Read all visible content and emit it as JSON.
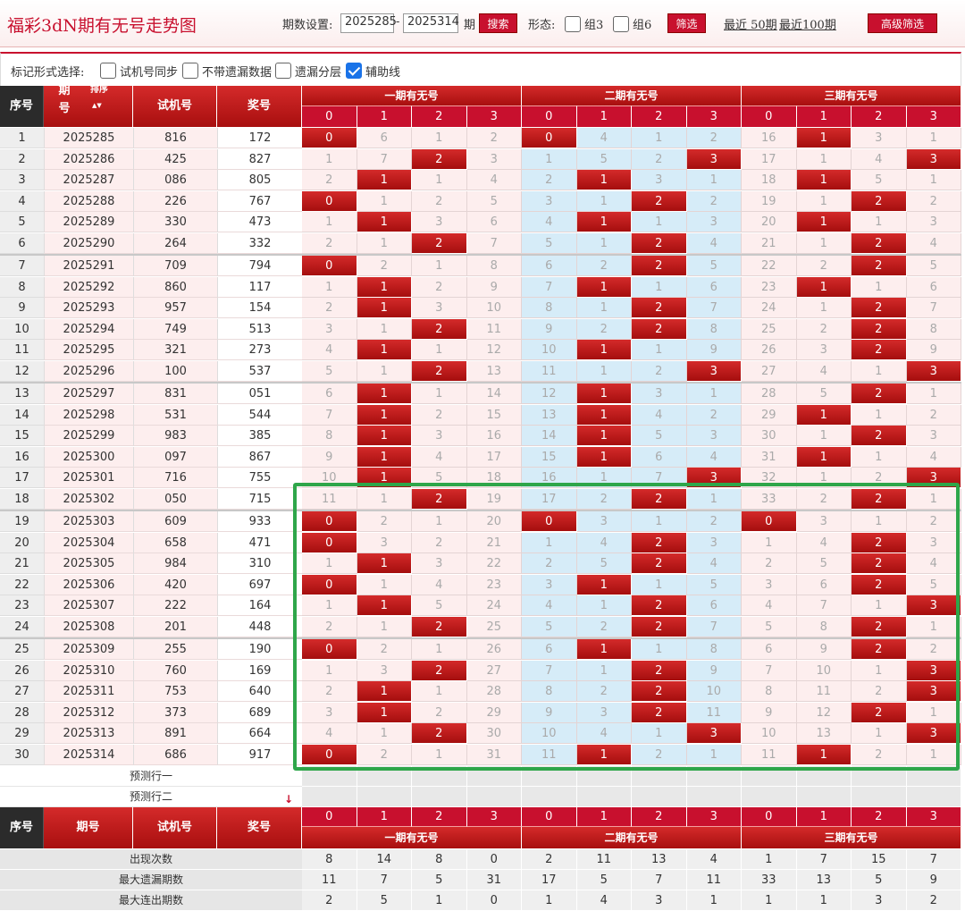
{
  "app": {
    "title": "福彩3dN期有无号走势图"
  },
  "toolbar": {
    "period_label": "期数设置:",
    "period_start": "2025285",
    "period_sep": "-",
    "period_end": "2025314",
    "period_unit": "期",
    "search_label": "搜索",
    "form_label": "形态:",
    "group3_label": "组3",
    "group6_label": "组6",
    "filter_label": "筛选",
    "recent50_label": "最近 50期",
    "recent100_label": "最近100期",
    "advanced_label": "高级筛选"
  },
  "options": {
    "label": "标记形式选择:",
    "items": [
      {
        "label": "试机号同步",
        "checked": false
      },
      {
        "label": "不带遗漏数据",
        "checked": false
      },
      {
        "label": "遗漏分层",
        "checked": false
      },
      {
        "label": "辅助线",
        "checked": true
      }
    ]
  },
  "table": {
    "headers": {
      "index": "序号",
      "period": "期号",
      "sort": "排序",
      "trial": "试机号",
      "winning": "奖号",
      "groups": [
        "一期有无号",
        "二期有无号",
        "三期有无号"
      ],
      "subcols": [
        "0",
        "1",
        "2",
        "3"
      ]
    },
    "rows": [
      {
        "i": "1",
        "p": "2025285",
        "t": "816",
        "w": "172",
        "v": [
          "0",
          "6",
          "1",
          "2",
          "0",
          "4",
          "1",
          "2",
          "16",
          "1",
          "3",
          "1"
        ]
      },
      {
        "i": "2",
        "p": "2025286",
        "t": "425",
        "w": "827",
        "v": [
          "1",
          "7",
          "2",
          "3",
          "1",
          "5",
          "2",
          "3",
          "17",
          "1",
          "4",
          "3"
        ]
      },
      {
        "i": "3",
        "p": "2025287",
        "t": "086",
        "w": "805",
        "v": [
          "2",
          "1",
          "1",
          "4",
          "2",
          "1",
          "3",
          "1",
          "18",
          "1",
          "5",
          "1"
        ]
      },
      {
        "i": "4",
        "p": "2025288",
        "t": "226",
        "w": "767",
        "v": [
          "0",
          "1",
          "2",
          "5",
          "3",
          "1",
          "2",
          "2",
          "19",
          "1",
          "2",
          "2"
        ]
      },
      {
        "i": "5",
        "p": "2025289",
        "t": "330",
        "w": "473",
        "v": [
          "1",
          "1",
          "3",
          "6",
          "4",
          "1",
          "1",
          "3",
          "20",
          "1",
          "1",
          "3"
        ]
      },
      {
        "i": "6",
        "p": "2025290",
        "t": "264",
        "w": "332",
        "v": [
          "2",
          "1",
          "2",
          "7",
          "5",
          "1",
          "2",
          "4",
          "21",
          "1",
          "2",
          "4"
        ]
      },
      {
        "i": "7",
        "p": "2025291",
        "t": "709",
        "w": "794",
        "v": [
          "0",
          "2",
          "1",
          "8",
          "6",
          "2",
          "2",
          "5",
          "22",
          "2",
          "2",
          "5"
        ]
      },
      {
        "i": "8",
        "p": "2025292",
        "t": "860",
        "w": "117",
        "v": [
          "1",
          "1",
          "2",
          "9",
          "7",
          "1",
          "1",
          "6",
          "23",
          "1",
          "1",
          "6"
        ]
      },
      {
        "i": "9",
        "p": "2025293",
        "t": "957",
        "w": "154",
        "v": [
          "2",
          "1",
          "3",
          "10",
          "8",
          "1",
          "2",
          "7",
          "24",
          "1",
          "2",
          "7"
        ]
      },
      {
        "i": "10",
        "p": "2025294",
        "t": "749",
        "w": "513",
        "v": [
          "3",
          "1",
          "2",
          "11",
          "9",
          "2",
          "2",
          "8",
          "25",
          "2",
          "2",
          "8"
        ]
      },
      {
        "i": "11",
        "p": "2025295",
        "t": "321",
        "w": "273",
        "v": [
          "4",
          "1",
          "1",
          "12",
          "10",
          "1",
          "1",
          "9",
          "26",
          "3",
          "2",
          "9"
        ]
      },
      {
        "i": "12",
        "p": "2025296",
        "t": "100",
        "w": "537",
        "v": [
          "5",
          "1",
          "2",
          "13",
          "11",
          "1",
          "2",
          "3",
          "27",
          "4",
          "1",
          "3"
        ]
      },
      {
        "i": "13",
        "p": "2025297",
        "t": "831",
        "w": "051",
        "v": [
          "6",
          "1",
          "1",
          "14",
          "12",
          "1",
          "3",
          "1",
          "28",
          "5",
          "2",
          "1"
        ]
      },
      {
        "i": "14",
        "p": "2025298",
        "t": "531",
        "w": "544",
        "v": [
          "7",
          "1",
          "2",
          "15",
          "13",
          "1",
          "4",
          "2",
          "29",
          "1",
          "1",
          "2"
        ]
      },
      {
        "i": "15",
        "p": "2025299",
        "t": "983",
        "w": "385",
        "v": [
          "8",
          "1",
          "3",
          "16",
          "14",
          "1",
          "5",
          "3",
          "30",
          "1",
          "2",
          "3"
        ]
      },
      {
        "i": "16",
        "p": "2025300",
        "t": "097",
        "w": "867",
        "v": [
          "9",
          "1",
          "4",
          "17",
          "15",
          "1",
          "6",
          "4",
          "31",
          "1",
          "1",
          "4"
        ]
      },
      {
        "i": "17",
        "p": "2025301",
        "t": "716",
        "w": "755",
        "v": [
          "10",
          "1",
          "5",
          "18",
          "16",
          "1",
          "7",
          "3",
          "32",
          "1",
          "2",
          "3"
        ]
      },
      {
        "i": "18",
        "p": "2025302",
        "t": "050",
        "w": "715",
        "v": [
          "11",
          "1",
          "2",
          "19",
          "17",
          "2",
          "2",
          "1",
          "33",
          "2",
          "2",
          "1"
        ]
      },
      {
        "i": "19",
        "p": "2025303",
        "t": "609",
        "w": "933",
        "v": [
          "0",
          "2",
          "1",
          "20",
          "0",
          "3",
          "1",
          "2",
          "0",
          "3",
          "1",
          "2"
        ]
      },
      {
        "i": "20",
        "p": "2025304",
        "t": "658",
        "w": "471",
        "v": [
          "0",
          "3",
          "2",
          "21",
          "1",
          "4",
          "2",
          "3",
          "1",
          "4",
          "2",
          "3"
        ]
      },
      {
        "i": "21",
        "p": "2025305",
        "t": "984",
        "w": "310",
        "v": [
          "1",
          "1",
          "3",
          "22",
          "2",
          "5",
          "2",
          "4",
          "2",
          "5",
          "2",
          "4"
        ]
      },
      {
        "i": "22",
        "p": "2025306",
        "t": "420",
        "w": "697",
        "v": [
          "0",
          "1",
          "4",
          "23",
          "3",
          "1",
          "1",
          "5",
          "3",
          "6",
          "2",
          "5"
        ]
      },
      {
        "i": "23",
        "p": "2025307",
        "t": "222",
        "w": "164",
        "v": [
          "1",
          "1",
          "5",
          "24",
          "4",
          "1",
          "2",
          "6",
          "4",
          "7",
          "1",
          "3"
        ]
      },
      {
        "i": "24",
        "p": "2025308",
        "t": "201",
        "w": "448",
        "v": [
          "2",
          "1",
          "2",
          "25",
          "5",
          "2",
          "2",
          "7",
          "5",
          "8",
          "2",
          "1"
        ]
      },
      {
        "i": "25",
        "p": "2025309",
        "t": "255",
        "w": "190",
        "v": [
          "0",
          "2",
          "1",
          "26",
          "6",
          "1",
          "1",
          "8",
          "6",
          "9",
          "2",
          "2"
        ]
      },
      {
        "i": "26",
        "p": "2025310",
        "t": "760",
        "w": "169",
        "v": [
          "1",
          "3",
          "2",
          "27",
          "7",
          "1",
          "2",
          "9",
          "7",
          "10",
          "1",
          "3"
        ]
      },
      {
        "i": "27",
        "p": "2025311",
        "t": "753",
        "w": "640",
        "v": [
          "2",
          "1",
          "1",
          "28",
          "8",
          "2",
          "2",
          "10",
          "8",
          "11",
          "2",
          "3"
        ]
      },
      {
        "i": "28",
        "p": "2025312",
        "t": "373",
        "w": "689",
        "v": [
          "3",
          "1",
          "2",
          "29",
          "9",
          "3",
          "2",
          "11",
          "9",
          "12",
          "2",
          "1"
        ]
      },
      {
        "i": "29",
        "p": "2025313",
        "t": "891",
        "w": "664",
        "v": [
          "4",
          "1",
          "2",
          "30",
          "10",
          "4",
          "1",
          "3",
          "10",
          "13",
          "1",
          "3"
        ]
      },
      {
        "i": "30",
        "p": "2025314",
        "t": "686",
        "w": "917",
        "v": [
          "0",
          "2",
          "1",
          "31",
          "11",
          "1",
          "2",
          "1",
          "11",
          "1",
          "2",
          "1"
        ]
      }
    ],
    "hits": [
      [
        0,
        4,
        9
      ],
      [
        2,
        7,
        11
      ],
      [
        1,
        5,
        9
      ],
      [
        0,
        6,
        10
      ],
      [
        1,
        5,
        9
      ],
      [
        2,
        6,
        10
      ],
      [
        0,
        6,
        10
      ],
      [
        1,
        5,
        9
      ],
      [
        1,
        6,
        10
      ],
      [
        2,
        6,
        10
      ],
      [
        1,
        5,
        10
      ],
      [
        2,
        7,
        11
      ],
      [
        1,
        5,
        10
      ],
      [
        1,
        5,
        9
      ],
      [
        1,
        5,
        10
      ],
      [
        1,
        5,
        9
      ],
      [
        1,
        7,
        11
      ],
      [
        2,
        6,
        10
      ],
      [
        0,
        4,
        8
      ],
      [
        0,
        6,
        10
      ],
      [
        1,
        6,
        10
      ],
      [
        0,
        5,
        10
      ],
      [
        1,
        6,
        11
      ],
      [
        2,
        6,
        10
      ],
      [
        0,
        5,
        10
      ],
      [
        2,
        6,
        11
      ],
      [
        1,
        6,
        11
      ],
      [
        1,
        6,
        10
      ],
      [
        2,
        7,
        11
      ],
      [
        0,
        5,
        9
      ]
    ],
    "predict": [
      "预测行一",
      "预测行二"
    ],
    "stats": [
      {
        "label": "出现次数",
        "values": [
          "8",
          "14",
          "8",
          "0",
          "2",
          "11",
          "13",
          "4",
          "1",
          "7",
          "15",
          "7"
        ]
      },
      {
        "label": "最大遗漏期数",
        "values": [
          "11",
          "7",
          "5",
          "31",
          "17",
          "5",
          "7",
          "11",
          "33",
          "13",
          "5",
          "9"
        ]
      },
      {
        "label": "最大连出期数",
        "values": [
          "2",
          "5",
          "1",
          "0",
          "1",
          "4",
          "3",
          "1",
          "1",
          "1",
          "3",
          "2"
        ]
      }
    ]
  }
}
